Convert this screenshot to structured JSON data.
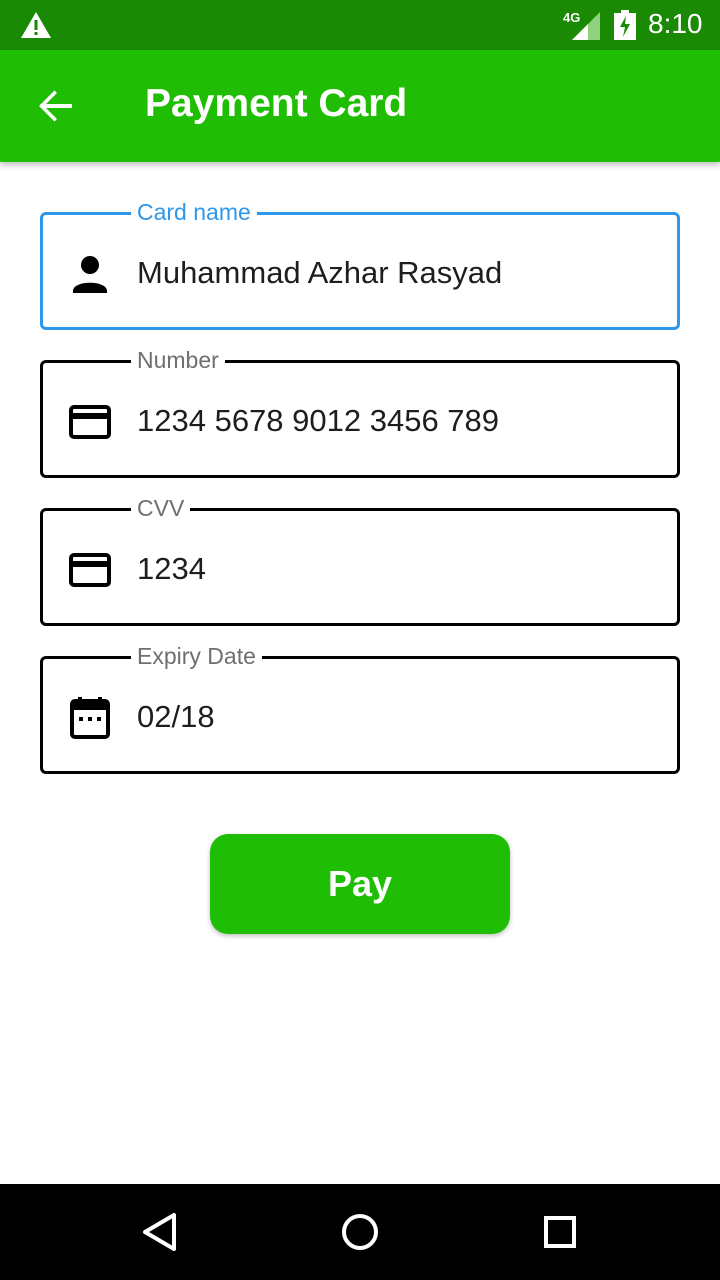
{
  "status_bar": {
    "network_label": "4G",
    "time": "8:10"
  },
  "app_bar": {
    "title": "Payment Card"
  },
  "fields": [
    {
      "label": "Card name",
      "value": "Muhammad Azhar Rasyad",
      "icon": "person-icon",
      "focused": true
    },
    {
      "label": "Number",
      "value": "1234 5678 9012 3456 789",
      "icon": "credit-card-icon",
      "focused": false
    },
    {
      "label": "CVV",
      "value": "1234",
      "icon": "credit-card-icon",
      "focused": false
    },
    {
      "label": "Expiry Date",
      "value": "02/18",
      "icon": "calendar-icon",
      "focused": false
    }
  ],
  "pay_button": {
    "label": "Pay"
  },
  "colors": {
    "primary": "#1fbe04",
    "status_bar": "#1a8a05",
    "focus": "#2e97ea"
  }
}
